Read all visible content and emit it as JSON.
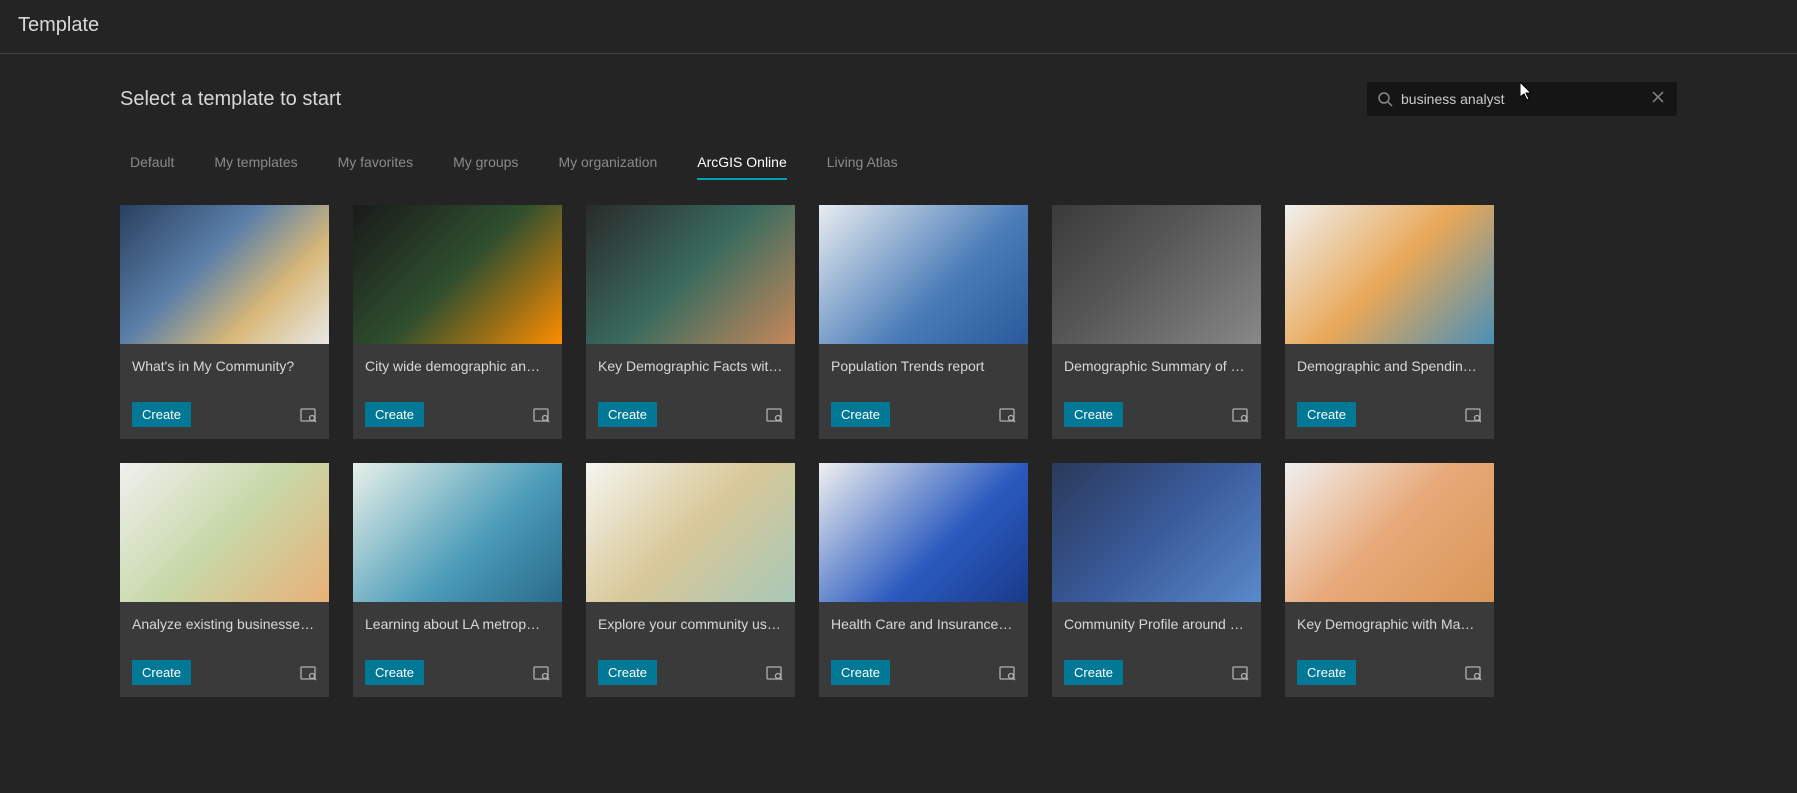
{
  "header": {
    "title": "Template"
  },
  "subtitle": "Select a template to start",
  "search": {
    "value": "business analyst"
  },
  "tabs": [
    {
      "label": "Default",
      "active": false
    },
    {
      "label": "My templates",
      "active": false
    },
    {
      "label": "My favorites",
      "active": false
    },
    {
      "label": "My groups",
      "active": false
    },
    {
      "label": "My organization",
      "active": false
    },
    {
      "label": "ArcGIS Online",
      "active": true
    },
    {
      "label": "Living Atlas",
      "active": false
    }
  ],
  "create_label": "Create",
  "cards": [
    {
      "title": "What's in My Community?"
    },
    {
      "title": "City wide demographic an…"
    },
    {
      "title": "Key Demographic Facts wit…"
    },
    {
      "title": "Population Trends report"
    },
    {
      "title": "Demographic Summary of …"
    },
    {
      "title": "Demographic and Spendin…"
    },
    {
      "title": "Analyze existing businesse…"
    },
    {
      "title": "Learning about LA metrop…"
    },
    {
      "title": "Explore your community us…"
    },
    {
      "title": "Health Care and Insurance …"
    },
    {
      "title": "Community Profile around …"
    },
    {
      "title": "Key Demographic with Ma…"
    }
  ]
}
